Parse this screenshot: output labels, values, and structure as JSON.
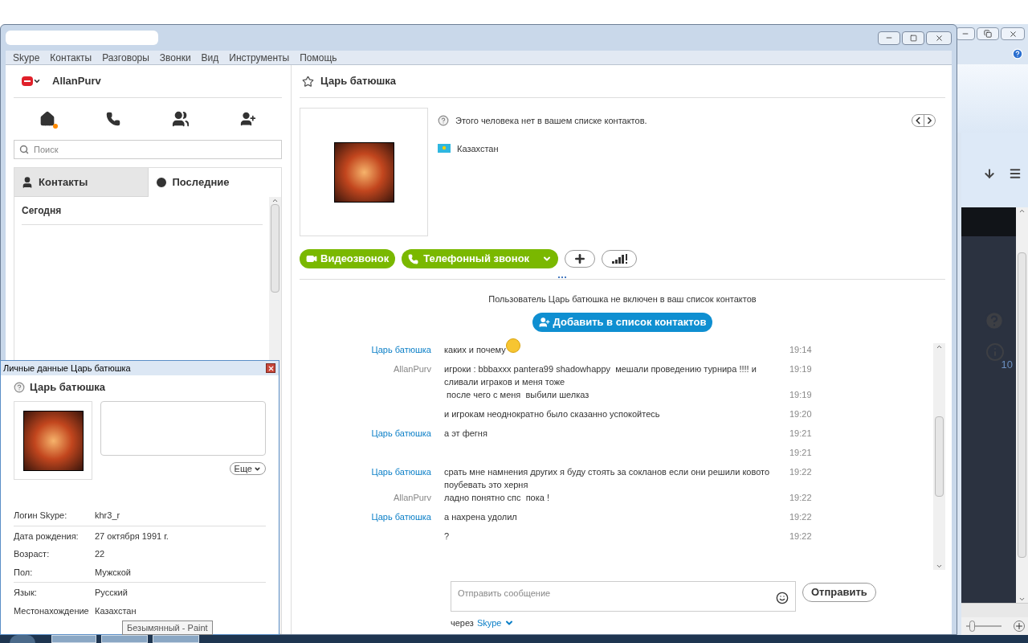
{
  "menu": [
    "Skype",
    "Контакты",
    "Разговоры",
    "Звонки",
    "Вид",
    "Инструменты",
    "Помощь"
  ],
  "user": {
    "name": "AllanPurv"
  },
  "search": {
    "placeholder": "Поиск"
  },
  "tabs": [
    {
      "label": "Контакты",
      "selected": false
    },
    {
      "label": "Последние",
      "selected": true
    }
  ],
  "recent": {
    "group": "Сегодня"
  },
  "contact": {
    "name": "Царь батюшка",
    "notice": "Этого человека нет в вашем списке контактов.",
    "country": "Казахстан"
  },
  "actions": {
    "video": "Видеозвонок",
    "phone": "Телефонный звонок"
  },
  "banner": {
    "text": "Пользователь Царь батюшка не включен в ваш список контактов",
    "button": "Добавить в список контактов"
  },
  "messages": [
    {
      "sender": "Царь батюшка",
      "kind": "contact",
      "text": "каких и почему",
      "time": "19:14",
      "emoticon": true
    },
    {
      "sender": "AllanPurv",
      "kind": "self",
      "text": "игроки : bbbaxxx pantera99 shadowhappy  мешали проведению турнира !!!! и сливали играков и меня тоже",
      "time": "19:19",
      "emoticon": false
    },
    {
      "text": " после чего с меня  выбили шелказ",
      "time": "19:19",
      "emoticon": false
    },
    {
      "text": "и игрокам неоднократно было сказанно успокойтесь",
      "time": "19:20",
      "emoticon": false
    },
    {
      "sender": "Царь батюшка",
      "kind": "contact",
      "text": "а эт фегня",
      "time": "19:21",
      "emoticon": false
    },
    {
      "time": "19:21",
      "emoticon": false
    },
    {
      "sender": "Царь батюшка",
      "kind": "contact",
      "text": "срать мне намнения других я буду стоять за сокланов если они решили ковото поубевать это херня",
      "time": "19:22",
      "emoticon": false
    },
    {
      "sender": "AllanPurv",
      "kind": "self",
      "text": "ладно понятно спс  пока !",
      "time": "19:22",
      "emoticon": false
    },
    {
      "sender": "Царь батюшка",
      "kind": "contact",
      "text": "а нахрена удолил",
      "time": "19:22",
      "emoticon": false
    },
    {
      "text": "?",
      "time": "19:22",
      "emoticon": false
    }
  ],
  "composer": {
    "placeholder": "Отправить сообщение",
    "send": "Отправить",
    "via_label": "через",
    "via_service": "Skype"
  },
  "profile_dialog": {
    "title": "Личные данные Царь батюшка",
    "name": "Царь батюшка",
    "more": "Еще",
    "sections": [
      [
        {
          "label": "Логин Skype:",
          "value": "khr3_r"
        }
      ],
      [
        {
          "label": "Дата рождения:",
          "value": "27 октября 1991 г."
        },
        {
          "label": "Возраст:",
          "value": "22"
        },
        {
          "label": "Пол:",
          "value": "Мужской"
        }
      ],
      [
        {
          "label": "Язык:",
          "value": "Русский"
        },
        {
          "label": "Местонахождение",
          "value": "Казахстан"
        }
      ]
    ]
  },
  "tooltip": "Безымянный - Paint",
  "background_window": {
    "badge": "10",
    "zoom": {
      "level": 0.15
    }
  }
}
